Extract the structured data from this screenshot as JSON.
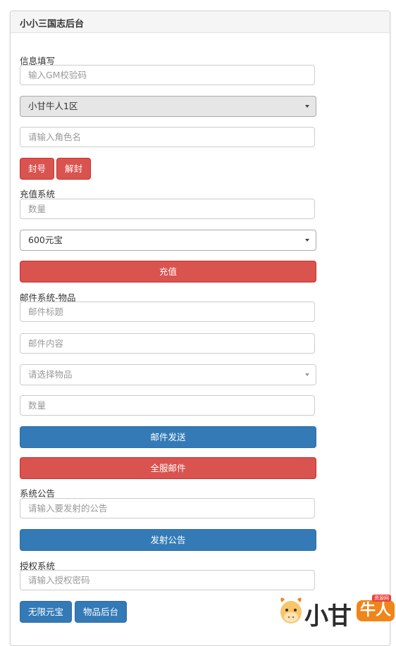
{
  "panel": {
    "title": "小小三国志后台"
  },
  "info": {
    "label": "信息填写",
    "gm_code_placeholder": "输入GM校验码",
    "server_select": "小甘牛人1区",
    "role_placeholder": "请输入角色名",
    "ban_button": "封号",
    "unban_button": "解封"
  },
  "recharge": {
    "label": "充值系统",
    "amount_placeholder": "数量",
    "gem_select": "600元宝",
    "recharge_button": "充值"
  },
  "mail": {
    "label": "邮件系统-物品",
    "title_placeholder": "邮件标题",
    "content_placeholder": "邮件内容",
    "item_select_placeholder": "请选择物品",
    "quantity_placeholder": "数量",
    "send_button": "邮件发送",
    "all_server_button": "全服邮件"
  },
  "announce": {
    "label": "系统公告",
    "input_placeholder": "请输入要发射的公告",
    "button": "发射公告"
  },
  "auth": {
    "label": "授权系统",
    "password_placeholder": "请输入授权密码",
    "unlimited_gems_button": "无限元宝",
    "items_backend_button": "物品后台"
  },
  "watermark": {
    "text_dark": "小甘",
    "text_badge": "牛人",
    "small_tag": "资源网"
  },
  "colors": {
    "danger": "#d9534f",
    "primary": "#337ab7",
    "watermark_orange": "#f08519"
  }
}
